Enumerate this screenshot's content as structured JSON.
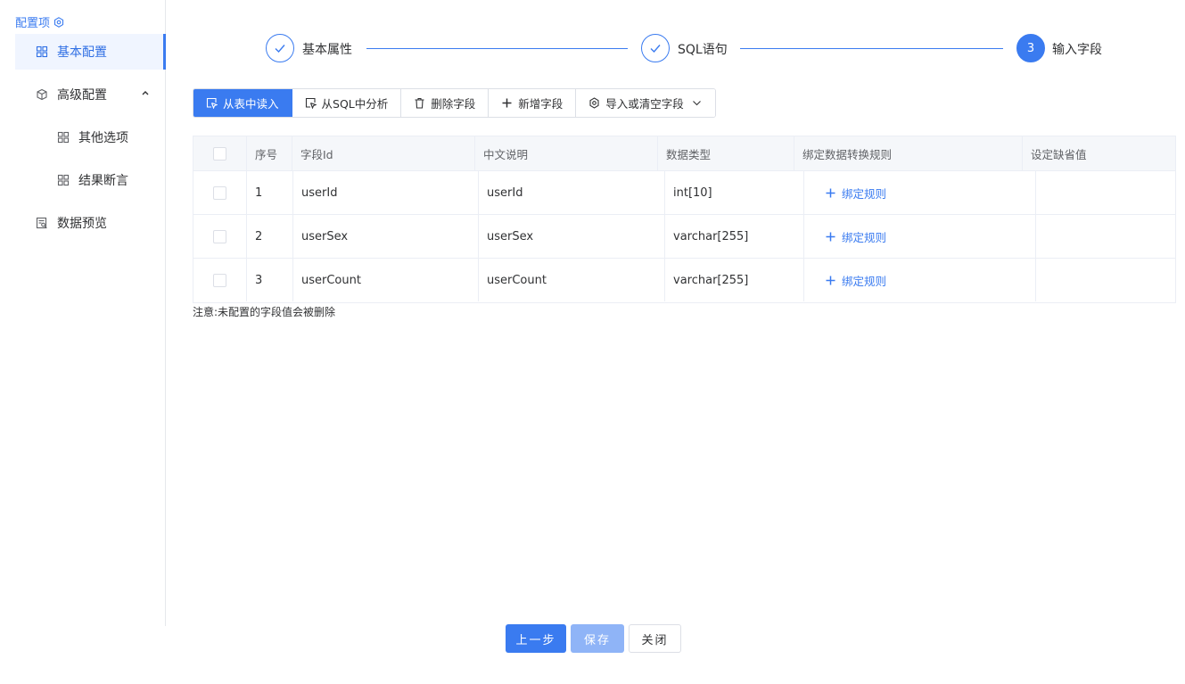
{
  "sidebar": {
    "title": "配置项",
    "items": [
      {
        "label": "基本配置",
        "icon": "grid-icon",
        "active": true
      },
      {
        "label": "高级配置",
        "icon": "cube-icon",
        "expanded": true
      },
      {
        "label": "其他选项",
        "icon": "grid-icon"
      },
      {
        "label": "结果断言",
        "icon": "grid-icon"
      },
      {
        "label": "数据预览",
        "icon": "preview-icon"
      }
    ]
  },
  "steps": [
    {
      "label": "基本属性",
      "status": "done"
    },
    {
      "label": "SQL语句",
      "status": "done"
    },
    {
      "label": "输入字段",
      "status": "current",
      "number": "3"
    }
  ],
  "toolbar": {
    "read_from_table": "从表中读入",
    "analyze_sql": "从SQL中分析",
    "delete_field": "删除字段",
    "add_field": "新增字段",
    "import_or_clear": "导入或清空字段"
  },
  "table": {
    "headers": [
      "序号",
      "字段Id",
      "中文说明",
      "数据类型",
      "绑定数据转换规则",
      "设定缺省值"
    ],
    "rows": [
      {
        "index": "1",
        "field_id": "userId",
        "desc": "userId",
        "type": "int[10]",
        "rule": "绑定规则",
        "default": ""
      },
      {
        "index": "2",
        "field_id": "userSex",
        "desc": "userSex",
        "type": "varchar[255]",
        "rule": "绑定规则",
        "default": ""
      },
      {
        "index": "3",
        "field_id": "userCount",
        "desc": "userCount",
        "type": "varchar[255]",
        "rule": "绑定规则",
        "default": ""
      }
    ]
  },
  "note": "注意:未配置的字段值会被删除",
  "buttons": {
    "prev": "上一步",
    "save": "保存",
    "close": "关闭"
  },
  "colors": {
    "accent": "#3a7bf0",
    "save_disabled": "#8fb4f7"
  }
}
